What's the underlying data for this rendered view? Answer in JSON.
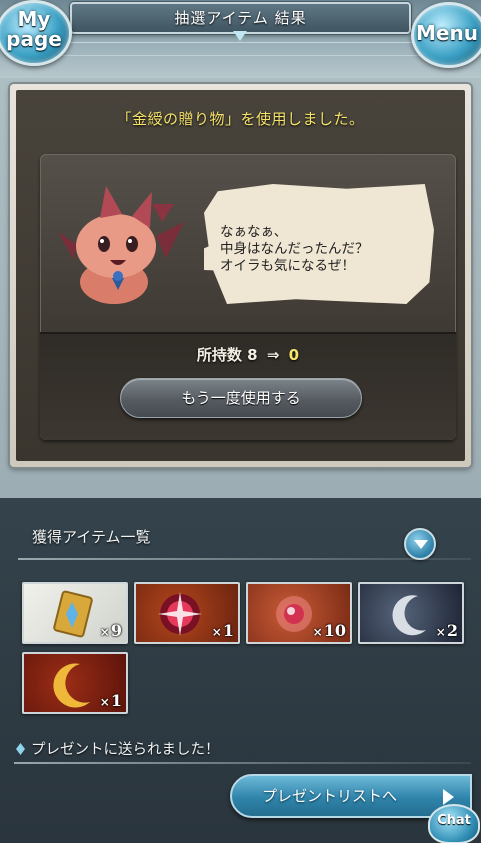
{
  "header": {
    "title": "抽選アイテム 結果",
    "mypage_line1": "My",
    "mypage_line2": "page",
    "menu_label": "Menu"
  },
  "result": {
    "used_message": "「金綬の贈り物」を使用しました。",
    "speech": "なぁなぁ、\n中身はなんだったんだ？\nオイラも気になるぜ！",
    "count_label": "所持数",
    "count_before": "8",
    "count_arrow": "⇒",
    "count_after": "0",
    "reuse_button": "もう一度使用する"
  },
  "obtained": {
    "header": "獲得アイテム一覧",
    "items": [
      {
        "name": "card",
        "qty": "9",
        "icon": "crystal-card-icon"
      },
      {
        "name": "red-orb",
        "qty": "1",
        "icon": "red-orb-icon"
      },
      {
        "name": "pink-orb",
        "qty": "10",
        "icon": "pink-orb-icon"
      },
      {
        "name": "silver-moon",
        "qty": "2",
        "icon": "silver-moon-icon"
      },
      {
        "name": "gold-moon",
        "qty": "1",
        "icon": "gold-moon-icon"
      }
    ],
    "x_mark": "×"
  },
  "present": {
    "note": "プレゼントに送られました！",
    "button": "プレゼントリストへ"
  },
  "chat": {
    "label": "Chat"
  },
  "colors": {
    "accent_yellow": "#f5e36a",
    "button_blue": "#2f84aa"
  }
}
